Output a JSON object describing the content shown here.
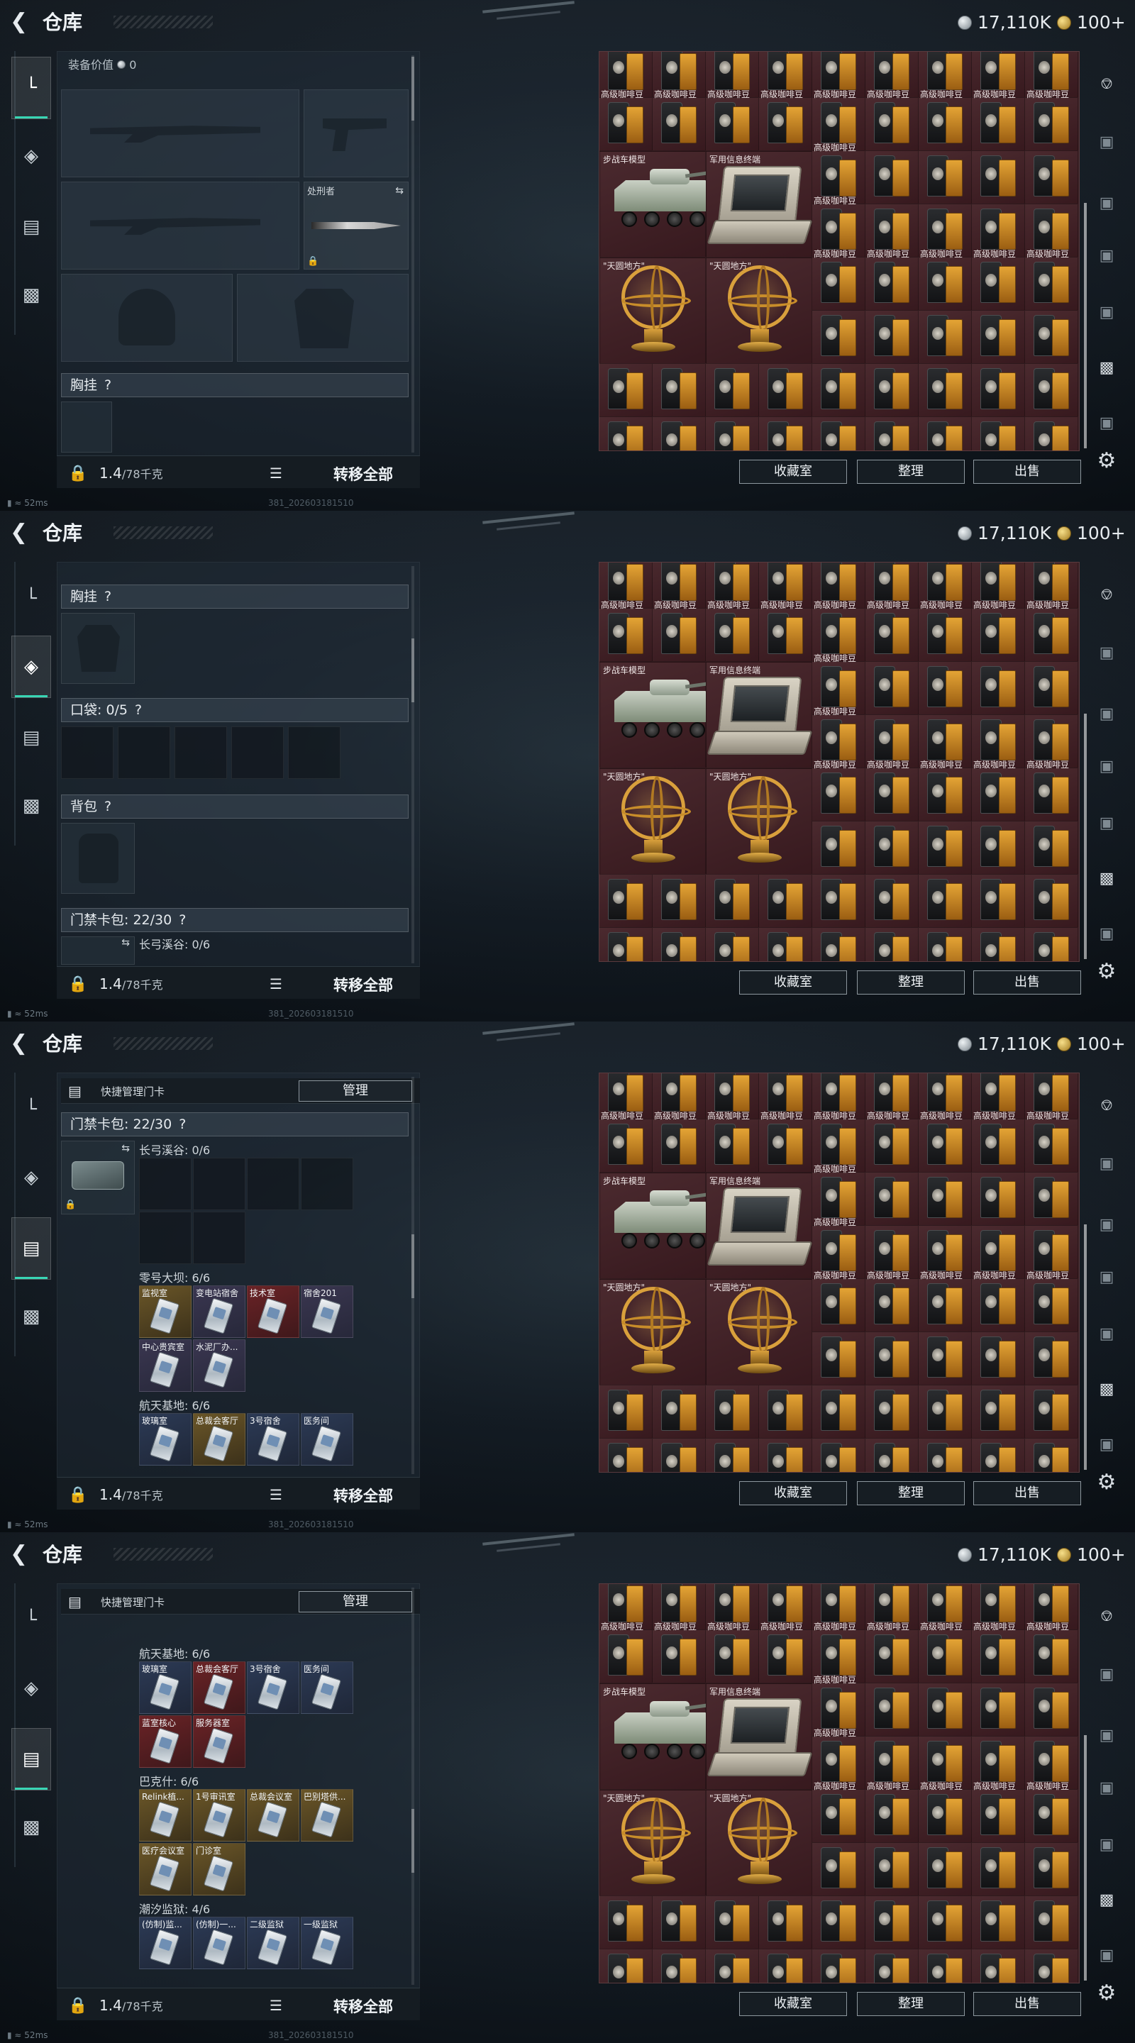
{
  "common": {
    "back_icon": "back-arrow-icon",
    "title": "仓库",
    "currency_silver": "17,110K",
    "currency_gold": "100+",
    "weight_value": "1.4",
    "weight_max": "/78千克",
    "transfer_all": "转移全部",
    "ping": "52ms",
    "build": "381_202603181510",
    "buttons": {
      "collection": "收藏室",
      "sort": "整理",
      "sell": "出售"
    },
    "manage_label": "快捷管理门卡",
    "manage_btn": "管理"
  },
  "nav_icons": [
    "gun-icon",
    "armor-icon",
    "keycard-icon",
    "briefcase-icon"
  ],
  "right_icons": [
    "helmet-icon",
    "container-icon",
    "container-iv-icon",
    "container-iv-icon",
    "container-iv-icon",
    "camera-icon",
    "container-iv-icon",
    "settings-gear-icon"
  ],
  "grid": {
    "coffee_label": "高级咖啡豆",
    "vehicle_label": "步战车模型",
    "terminal_label": "军用信息终端",
    "globe_label": "\"天圆地方\""
  },
  "s1": {
    "equip_value_label": "装备价值",
    "equip_value": "0",
    "executioner": "处刑者",
    "chest_rig": "胸挂",
    "help": "?"
  },
  "s2": {
    "chest_rig": "胸挂",
    "pocket": "口袋: 0/5",
    "backpack": "背包",
    "keycard_bag": "门禁卡包: 22/30",
    "changgong": "长弓溪谷: 0/6",
    "help": "?"
  },
  "s3": {
    "keycard_bag": "门禁卡包: 22/30",
    "changgong": "长弓溪谷: 0/6",
    "dam": "零号大坝: 6/6",
    "dam_cards": [
      "监视室",
      "变电站宿舍",
      "技术室",
      "宿舍201",
      "中心贵宾室",
      "水泥厂办..."
    ],
    "aero": "航天基地: 6/6",
    "aero_cards": [
      "玻璃室",
      "总裁会客厅",
      "3号宿舍",
      "医务间"
    ],
    "help": "?"
  },
  "s4": {
    "aero": "航天基地: 6/6",
    "aero_cards": [
      "玻璃室",
      "总裁会客厅",
      "3号宿舍",
      "医务间",
      "蓝室核心",
      "服务器室"
    ],
    "bakesh": "巴克什: 6/6",
    "bakesh_cards": [
      "Relink植...",
      "1号审讯室",
      "总裁会议室",
      "巴别塔供...",
      "医疗会议室",
      "门诊室"
    ],
    "tide": "潮汐监狱: 4/6",
    "tide_cards": [
      "(仿制)监...",
      "(仿制)一...",
      "二级监狱",
      "一级监狱"
    ]
  }
}
